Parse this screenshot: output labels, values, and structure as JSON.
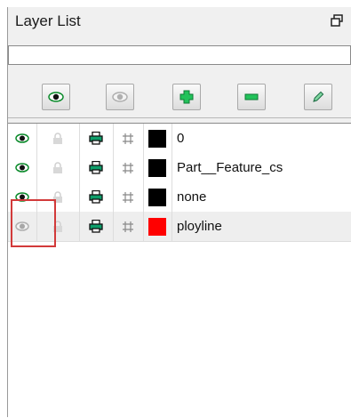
{
  "panel": {
    "title": "Layer List",
    "search_value": "",
    "search_placeholder": ""
  },
  "toolbar": {
    "buttons": [
      {
        "name": "show-all-button",
        "icon": "eye-icon",
        "enabled": true
      },
      {
        "name": "hide-all-button",
        "icon": "eye-icon",
        "enabled": false
      },
      {
        "name": "add-layer-button",
        "icon": "plus-icon",
        "enabled": true
      },
      {
        "name": "remove-layer-button",
        "icon": "minus-icon",
        "enabled": true
      },
      {
        "name": "edit-layer-button",
        "icon": "pencil-icon",
        "enabled": true
      }
    ]
  },
  "layers": [
    {
      "name": "0",
      "visible": true,
      "color": "#000000"
    },
    {
      "name": "Part__Feature_cs",
      "visible": true,
      "color": "#000000"
    },
    {
      "name": "none",
      "visible": true,
      "color": "#000000"
    },
    {
      "name": "ployline",
      "visible": false,
      "color": "#ff0000"
    }
  ],
  "colors": {
    "eye_on": "#0a8a2a",
    "eye_off": "#a8a8a8",
    "printer": "#0e9e6a",
    "highlight": "#d23a3a"
  }
}
